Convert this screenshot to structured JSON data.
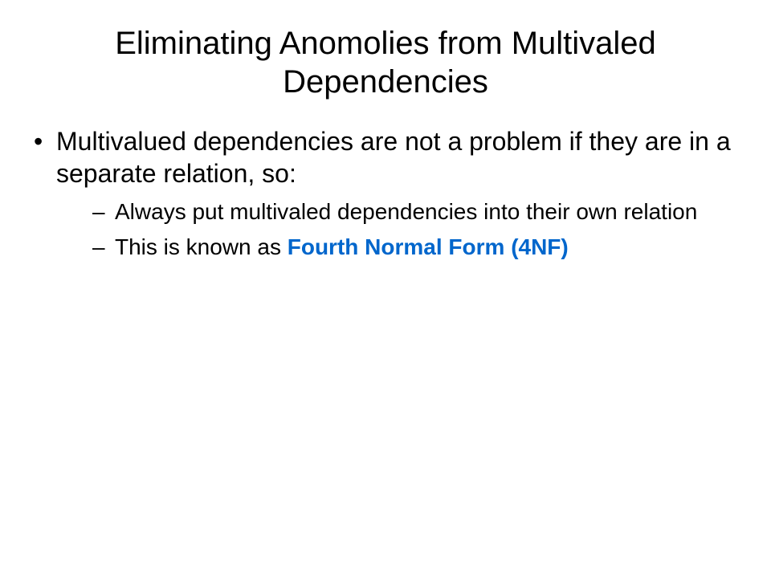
{
  "title": "Eliminating Anomolies from Multivaled Dependencies",
  "bullets": [
    {
      "text": "Multivalued dependencies are not a problem if they are in a separate relation, so:",
      "subitems": [
        {
          "prefix": "Always put multivaled dependencies into their own relation",
          "highlight": ""
        },
        {
          "prefix": "This is known as ",
          "highlight": "Fourth Normal Form (4NF)"
        }
      ]
    }
  ]
}
